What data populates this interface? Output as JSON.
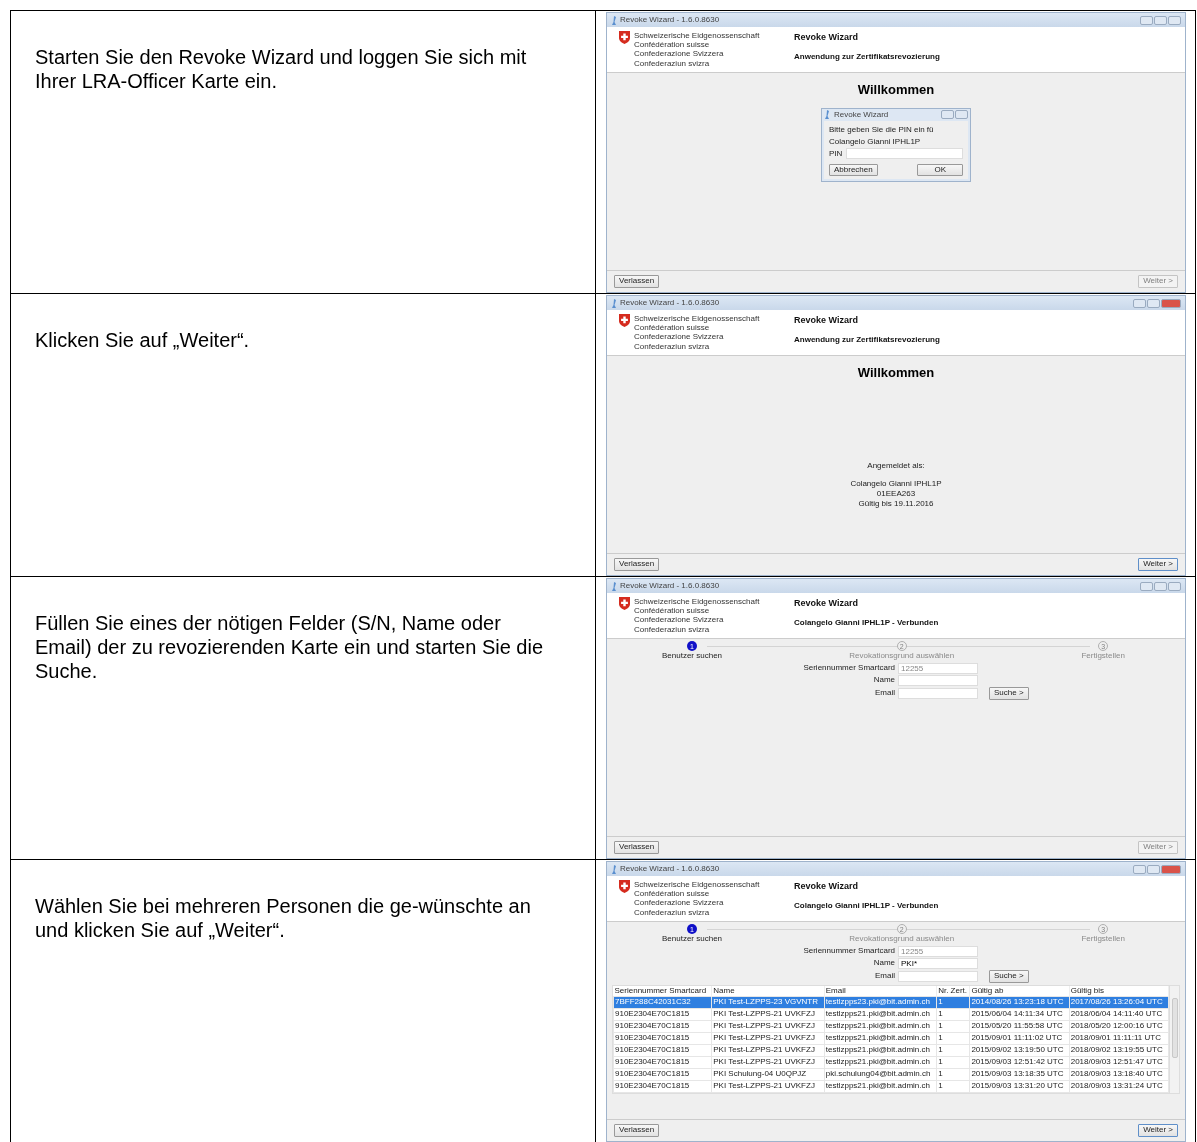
{
  "steps": [
    {
      "instruction": "Starten Sie den Revoke Wizard und loggen Sie sich mit Ihrer LRA-Officer Karte ein.",
      "window": {
        "title": "Revoke Wizard - 1.6.0.8630",
        "active": false,
        "org_lines": [
          "Schweizerische Eidgenossenschaft",
          "Confédération suisse",
          "Confederazione Svizzera",
          "Confederaziun svizra"
        ],
        "app_title": "Revoke Wizard",
        "subtitle": "Anwendung zur Zertifikatsrevozierung",
        "heading": "Willkommen",
        "dialog": {
          "title": "Revoke Wizard",
          "lines": [
            "Bitte geben Sie die PIN ein fü",
            "Colangelo Gianni IPHL1P"
          ],
          "field_label": "PIN",
          "buttons": [
            "Abbrechen",
            "OK"
          ]
        },
        "exit_button": "Verlassen",
        "next_button": {
          "label": "Weiter >",
          "disabled": true
        }
      }
    },
    {
      "instruction": "Klicken Sie auf „Weiter“.",
      "window": {
        "title": "Revoke Wizard - 1.6.0.8630",
        "active": true,
        "org_lines": [
          "Schweizerische Eidgenossenschaft",
          "Confédération suisse",
          "Confederazione Svizzera",
          "Confederaziun svizra"
        ],
        "app_title": "Revoke Wizard",
        "subtitle": "Anwendung zur Zertifikatsrevozierung",
        "heading": "Willkommen",
        "login_info": {
          "label": "Angemeldet als:",
          "lines": [
            "Colangelo Gianni IPHL1P",
            "01EEA263",
            "Gültig bis 19.11.2016"
          ]
        },
        "exit_button": "Verlassen",
        "next_button": {
          "label": "Weiter >",
          "disabled": false
        }
      }
    },
    {
      "instruction": "Füllen Sie eines der nötigen Felder (S/N, Name oder Email) der zu revozierenden Karte ein und starten Sie die Suche.",
      "window": {
        "title": "Revoke Wizard - 1.6.0.8630",
        "active": false,
        "org_lines": [
          "Schweizerische Eidgenossenschaft",
          "Confédération suisse",
          "Confederazione Svizzera",
          "Confederaziun svizra"
        ],
        "app_title": "Revoke Wizard",
        "subtitle": "Colangelo Gianni IPHL1P - Verbunden",
        "stepper": [
          {
            "number": "1",
            "label": "Benutzer suchen",
            "selected": true
          },
          {
            "number": "2",
            "label": "Revokationsgrund auswählen",
            "selected": false
          },
          {
            "number": "3",
            "label": "Fertigstellen",
            "selected": false
          }
        ],
        "form": {
          "fields": [
            {
              "label": "Seriennummer Smartcard",
              "placeholder": "12255"
            },
            {
              "label": "Name"
            },
            {
              "label": "Email"
            }
          ],
          "search_button": "Suche >"
        },
        "exit_button": "Verlassen",
        "next_button": {
          "label": "Weiter >",
          "disabled": true
        }
      }
    },
    {
      "instruction": "Wählen Sie bei mehreren Personen die ge-wünschte an und klicken Sie auf „Weiter“.",
      "window": {
        "title": "Revoke Wizard - 1.6.0.8630",
        "active": true,
        "org_lines": [
          "Schweizerische Eidgenossenschaft",
          "Confédération suisse",
          "Confederazione Svizzera",
          "Confederaziun svizra"
        ],
        "app_title": "Revoke Wizard",
        "subtitle": "Colangelo Gianni IPHL1P - Verbunden",
        "stepper": [
          {
            "number": "1",
            "label": "Benutzer suchen",
            "selected": true
          },
          {
            "number": "2",
            "label": "Revokationsgrund auswählen",
            "selected": false
          },
          {
            "number": "3",
            "label": "Fertigstellen",
            "selected": false
          }
        ],
        "form": {
          "fields": [
            {
              "label": "Seriennummer Smartcard",
              "placeholder": "12255"
            },
            {
              "label": "Name",
              "value": "PKI*"
            },
            {
              "label": "Email"
            }
          ],
          "search_button": "Suche >"
        },
        "results": {
          "columns": [
            "Seriennummer Smartcard",
            "Name",
            "Email",
            "Nr. Zert.",
            "Gültig ab",
            "Gültig bis"
          ],
          "rows": [
            {
              "cells": [
                "7BFF288C42031C32",
                "PKI Test-LZPPS-23 VGVNTR",
                "testlzpps23.pki@bit.admin.ch",
                "1",
                "2014/08/26 13:23:18 UTC",
                "2017/08/26 13:26:04 UTC"
              ],
              "selected": true
            },
            {
              "cells": [
                "910E2304E70C1815",
                "PKI Test-LZPPS-21 UVKFZJ",
                "testlzpps21.pki@bit.admin.ch",
                "1",
                "2015/06/04 14:11:34 UTC",
                "2018/06/04 14:11:40 UTC"
              ],
              "selected": false
            },
            {
              "cells": [
                "910E2304E70C1815",
                "PKI Test-LZPPS-21 UVKFZJ",
                "testlzpps21.pki@bit.admin.ch",
                "1",
                "2015/05/20 11:55:58 UTC",
                "2018/05/20 12:00:16 UTC"
              ],
              "selected": false
            },
            {
              "cells": [
                "910E2304E70C1815",
                "PKI Test-LZPPS-21 UVKFZJ",
                "testlzpps21.pki@bit.admin.ch",
                "1",
                "2015/09/01 11:11:02 UTC",
                "2018/09/01 11:11:11 UTC"
              ],
              "selected": false
            },
            {
              "cells": [
                "910E2304E70C1815",
                "PKI Test-LZPPS-21 UVKFZJ",
                "testlzpps21.pki@bit.admin.ch",
                "1",
                "2015/09/02 13:19:50 UTC",
                "2018/09/02 13:19:55 UTC"
              ],
              "selected": false
            },
            {
              "cells": [
                "910E2304E70C1815",
                "PKI Test-LZPPS-21 UVKFZJ",
                "testlzpps21.pki@bit.admin.ch",
                "1",
                "2015/09/03 12:51:42 UTC",
                "2018/09/03 12:51:47 UTC"
              ],
              "selected": false
            },
            {
              "cells": [
                "910E2304E70C1815",
                "PKI Schulung-04 U0QPJZ",
                "pki.schulung04@bit.admin.ch",
                "1",
                "2015/09/03 13:18:35 UTC",
                "2018/09/03 13:18:40 UTC"
              ],
              "selected": false
            },
            {
              "cells": [
                "910E2304E70C1815",
                "PKI Test-LZPPS-21 UVKFZJ",
                "testlzpps21.pki@bit.admin.ch",
                "1",
                "2015/09/03 13:31:20 UTC",
                "2018/09/03 13:31:24 UTC"
              ],
              "selected": false
            }
          ]
        },
        "exit_button": "Verlassen",
        "next_button": {
          "label": "Weiter >",
          "disabled": false
        }
      }
    }
  ]
}
